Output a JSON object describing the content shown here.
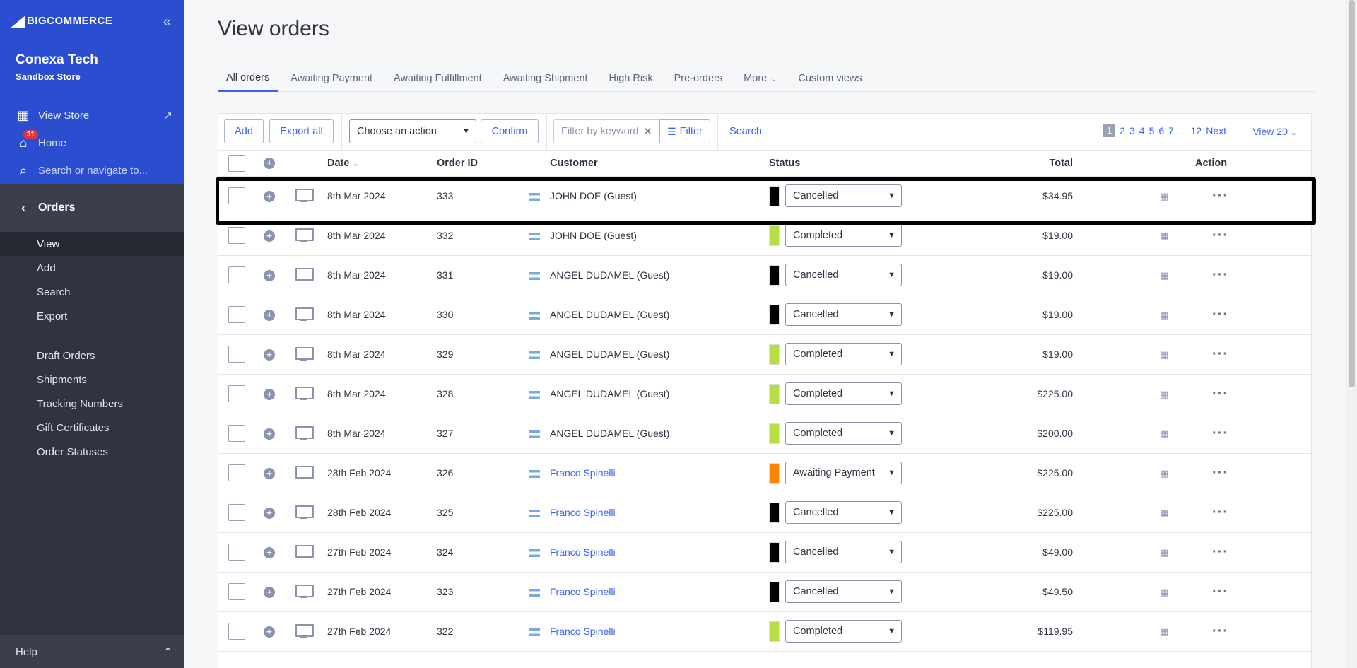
{
  "sidebar": {
    "logo": "BIGCOMMERCE",
    "store_name": "Conexa Tech",
    "store_sub": "Sandbox Store",
    "view_store": "View Store",
    "home": "Home",
    "home_badge": "31",
    "search_placeholder": "Search or navigate to...",
    "section": "Orders",
    "menu": [
      "View",
      "Add",
      "Search",
      "Export"
    ],
    "menu2": [
      "Draft Orders",
      "Shipments",
      "Tracking Numbers",
      "Gift Certificates",
      "Order Statuses"
    ],
    "help": "Help"
  },
  "page_title": "View orders",
  "tabs": [
    "All orders",
    "Awaiting Payment",
    "Awaiting Fulfillment",
    "Awaiting Shipment",
    "High Risk",
    "Pre-orders",
    "More",
    "Custom views"
  ],
  "toolbar": {
    "add": "Add",
    "export_all": "Export all",
    "action_select": "Choose an action",
    "confirm": "Confirm",
    "filter_placeholder": "Filter by keyword",
    "filter": "Filter",
    "search": "Search",
    "pages": [
      "1",
      "2",
      "3",
      "4",
      "5",
      "6",
      "7",
      "...",
      "12",
      "Next"
    ],
    "view": "View 20"
  },
  "columns": {
    "date": "Date",
    "order_id": "Order ID",
    "customer": "Customer",
    "status": "Status",
    "total": "Total",
    "action": "Action"
  },
  "status_colors": {
    "Cancelled": "#000000",
    "Completed": "#b6de44",
    "Awaiting Payment": "#fd8400"
  },
  "orders": [
    {
      "date": "8th Mar 2024",
      "id": "333",
      "customer": "JOHN DOE (Guest)",
      "link": false,
      "status": "Cancelled",
      "total": "$34.95"
    },
    {
      "date": "8th Mar 2024",
      "id": "332",
      "customer": "JOHN DOE (Guest)",
      "link": false,
      "status": "Completed",
      "total": "$19.00"
    },
    {
      "date": "8th Mar 2024",
      "id": "331",
      "customer": "ANGEL DUDAMEL (Guest)",
      "link": false,
      "status": "Cancelled",
      "total": "$19.00"
    },
    {
      "date": "8th Mar 2024",
      "id": "330",
      "customer": "ANGEL DUDAMEL (Guest)",
      "link": false,
      "status": "Cancelled",
      "total": "$19.00"
    },
    {
      "date": "8th Mar 2024",
      "id": "329",
      "customer": "ANGEL DUDAMEL (Guest)",
      "link": false,
      "status": "Completed",
      "total": "$19.00"
    },
    {
      "date": "8th Mar 2024",
      "id": "328",
      "customer": "ANGEL DUDAMEL (Guest)",
      "link": false,
      "status": "Completed",
      "total": "$225.00"
    },
    {
      "date": "8th Mar 2024",
      "id": "327",
      "customer": "ANGEL DUDAMEL (Guest)",
      "link": false,
      "status": "Completed",
      "total": "$200.00"
    },
    {
      "date": "28th Feb 2024",
      "id": "326",
      "customer": "Franco Spinelli",
      "link": true,
      "status": "Awaiting Payment",
      "total": "$225.00"
    },
    {
      "date": "28th Feb 2024",
      "id": "325",
      "customer": "Franco Spinelli",
      "link": true,
      "status": "Cancelled",
      "total": "$225.00"
    },
    {
      "date": "27th Feb 2024",
      "id": "324",
      "customer": "Franco Spinelli",
      "link": true,
      "status": "Cancelled",
      "total": "$49.00"
    },
    {
      "date": "27th Feb 2024",
      "id": "323",
      "customer": "Franco Spinelli",
      "link": true,
      "status": "Cancelled",
      "total": "$49.50"
    },
    {
      "date": "27th Feb 2024",
      "id": "322",
      "customer": "Franco Spinelli",
      "link": true,
      "status": "Completed",
      "total": "$119.95"
    }
  ]
}
